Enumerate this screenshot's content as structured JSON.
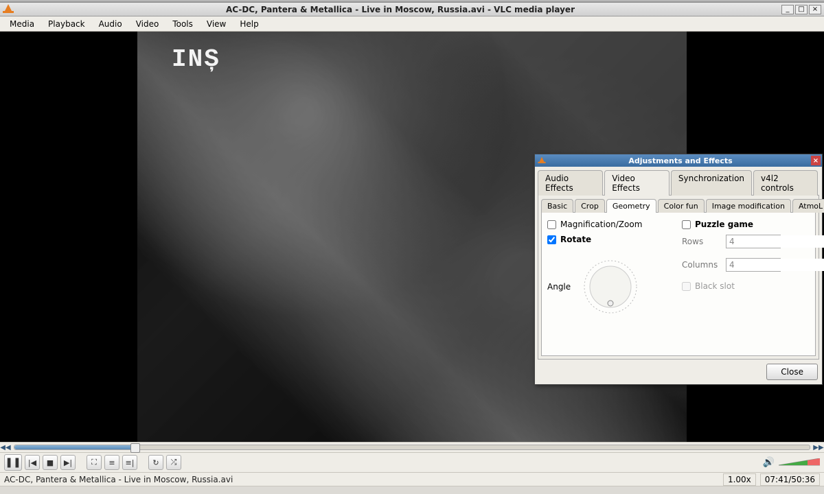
{
  "window": {
    "title": "AC-DC, Pantera & Metallica - Live in Moscow, Russia.avi - VLC media player"
  },
  "menu": {
    "media": "Media",
    "playback": "Playback",
    "audio": "Audio",
    "video": "Video",
    "tools": "Tools",
    "view": "View",
    "help": "Help"
  },
  "video_overlay": "INȘ",
  "playback": {
    "speed": "1.00x",
    "time": "07:41/50:36",
    "file": "AC-DC, Pantera & Metallica - Live in Moscow, Russia.avi"
  },
  "dialog": {
    "title": "Adjustments and Effects",
    "tabs1": {
      "audio_effects": "Audio Effects",
      "video_effects": "Video Effects",
      "synchronization": "Synchronization",
      "v4l2": "v4l2 controls"
    },
    "tabs2": {
      "basic": "Basic",
      "crop": "Crop",
      "geometry": "Geometry",
      "color_fun": "Color fun",
      "image_mod": "Image modification",
      "atmo": "AtmoL"
    },
    "geometry": {
      "magnification": "Magnification/Zoom",
      "rotate": "Rotate",
      "angle": "Angle",
      "puzzle": "Puzzle game",
      "rows_label": "Rows",
      "rows_value": "4",
      "cols_label": "Columns",
      "cols_value": "4",
      "black_slot": "Black slot"
    },
    "close": "Close"
  }
}
